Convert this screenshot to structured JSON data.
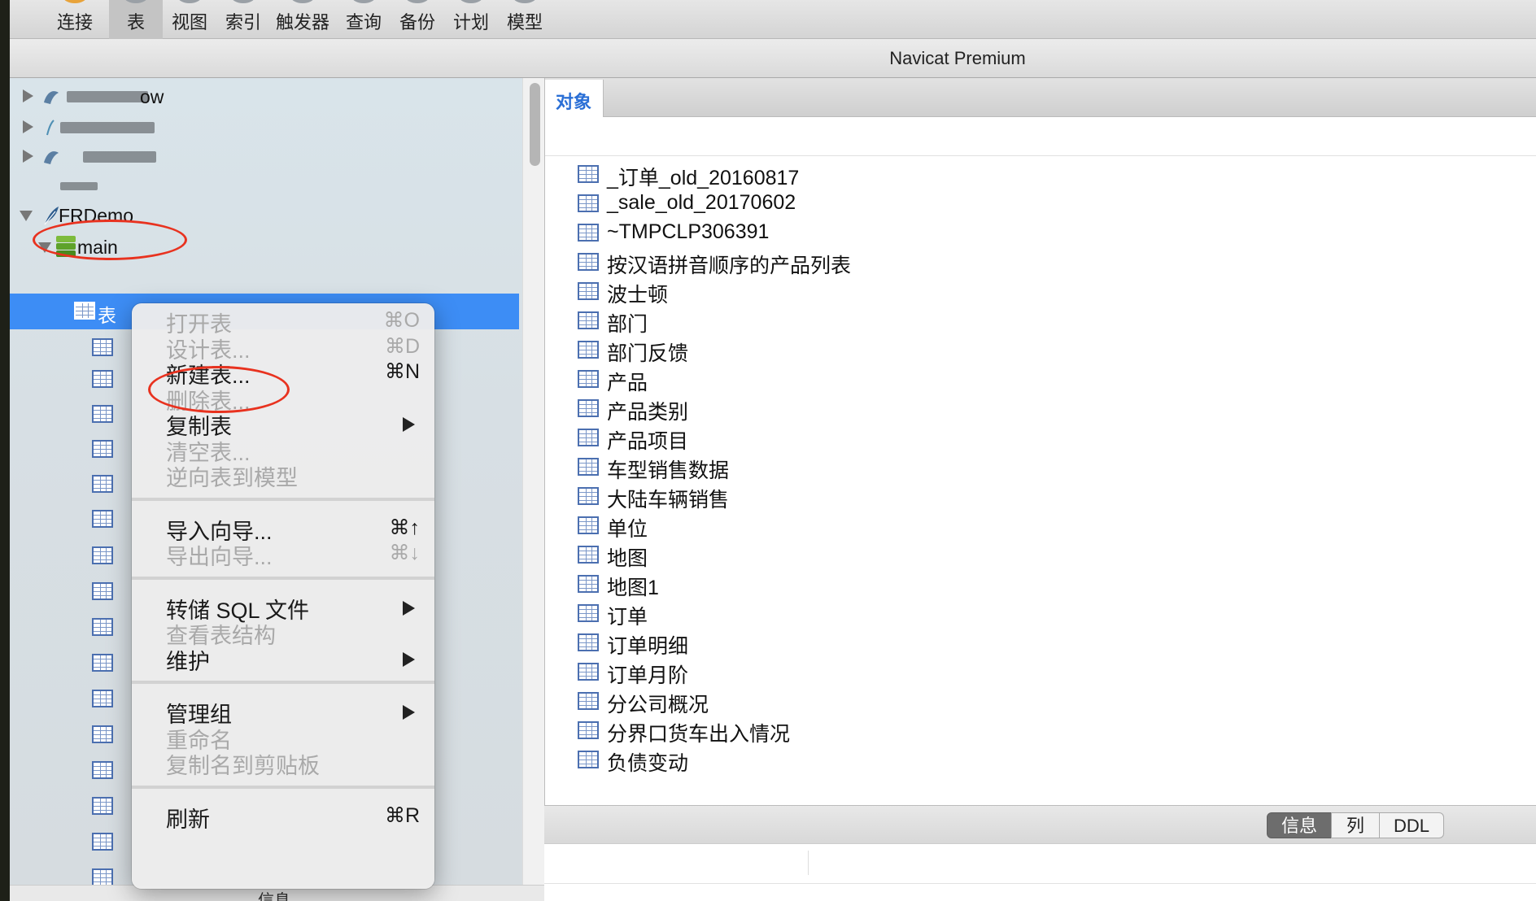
{
  "toolbar": {
    "items": [
      {
        "label": "连接"
      },
      {
        "label": "表"
      },
      {
        "label": "视图"
      },
      {
        "label": "索引"
      },
      {
        "label": "触发器"
      },
      {
        "label": "查询"
      },
      {
        "label": "备份"
      },
      {
        "label": "计划"
      },
      {
        "label": "模型"
      }
    ],
    "active_index": 1
  },
  "window": {
    "title": "Navicat Premium"
  },
  "sidebar": {
    "blurred_connections": [
      {
        "suffix": "ow"
      },
      {
        "suffix": ""
      },
      {
        "suffix": ""
      }
    ],
    "connection": {
      "label": "FRDemo"
    },
    "database": {
      "label": "main"
    },
    "tables_node": {
      "label": "表"
    },
    "footer_label": "信息"
  },
  "context_menu": {
    "groups": [
      [
        {
          "label": "打开表",
          "shortcut": "⌘O",
          "enabled": false,
          "submenu": false
        },
        {
          "label": "设计表...",
          "shortcut": "⌘D",
          "enabled": false,
          "submenu": false
        },
        {
          "label": "新建表...",
          "shortcut": "⌘N",
          "enabled": true,
          "submenu": false
        },
        {
          "label": "删除表...",
          "shortcut": "",
          "enabled": false,
          "submenu": false
        },
        {
          "label": "复制表",
          "shortcut": "",
          "enabled": true,
          "submenu": true
        },
        {
          "label": "清空表...",
          "shortcut": "",
          "enabled": false,
          "submenu": false
        },
        {
          "label": "逆向表到模型",
          "shortcut": "",
          "enabled": false,
          "submenu": false
        }
      ],
      [
        {
          "label": "导入向导...",
          "shortcut": "⌘↑",
          "enabled": true,
          "submenu": false
        },
        {
          "label": "导出向导...",
          "shortcut": "⌘↓",
          "enabled": false,
          "submenu": false
        }
      ],
      [
        {
          "label": "转储 SQL 文件",
          "shortcut": "",
          "enabled": true,
          "submenu": true
        },
        {
          "label": "查看表结构",
          "shortcut": "",
          "enabled": false,
          "submenu": false
        },
        {
          "label": "维护",
          "shortcut": "",
          "enabled": true,
          "submenu": true
        }
      ],
      [
        {
          "label": "管理组",
          "shortcut": "",
          "enabled": true,
          "submenu": true
        },
        {
          "label": "重命名",
          "shortcut": "",
          "enabled": false,
          "submenu": false
        },
        {
          "label": "复制名到剪贴板",
          "shortcut": "",
          "enabled": false,
          "submenu": false
        }
      ],
      [
        {
          "label": "刷新",
          "shortcut": "⌘R",
          "enabled": true,
          "submenu": false
        }
      ]
    ]
  },
  "main": {
    "tab": {
      "label": "对象"
    },
    "objects": [
      "_订单_old_20160817",
      "_sale_old_20170602",
      "~TMPCLP306391",
      "按汉语拼音顺序的产品列表",
      "波士顿",
      "部门",
      "部门反馈",
      "产品",
      "产品类别",
      "产品项目",
      "车型销售数据",
      "大陆车辆销售",
      "单位",
      "地图",
      "地图1",
      "订单",
      "订单明细",
      "订单月阶",
      "分公司概况",
      "分界口货车出入情况",
      "负债变动"
    ]
  },
  "info_tabs": {
    "items": [
      {
        "label": "信息"
      },
      {
        "label": "列"
      },
      {
        "label": "DDL"
      }
    ],
    "active_index": 0
  },
  "colors": {
    "selection": "#3d8df5",
    "annotation": "#e8321f",
    "tab_accent": "#2a6fd6"
  }
}
